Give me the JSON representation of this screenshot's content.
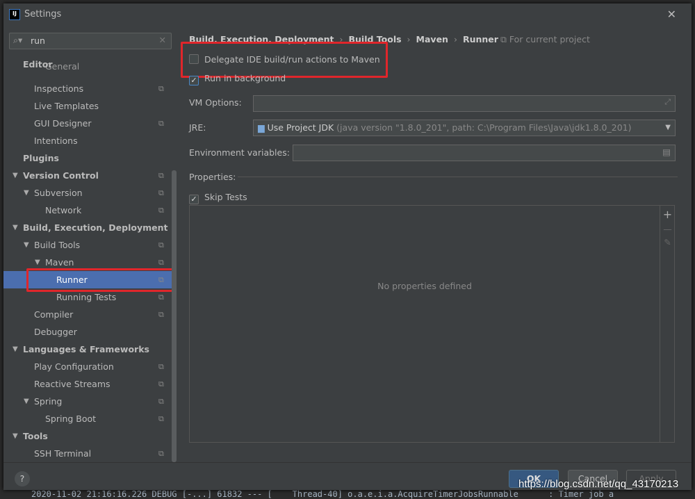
{
  "window": {
    "title": "Settings",
    "logo": "IJ"
  },
  "search": {
    "value": "run"
  },
  "tree": [
    {
      "label": "Editor",
      "level": 0,
      "bold": true,
      "arrow": false,
      "copy": false
    },
    {
      "label": "General",
      "level": 2,
      "bold": false,
      "arrow": false,
      "copy": false
    },
    {
      "label": "Inspections",
      "level": 1,
      "bold": false,
      "arrow": false,
      "copy": true
    },
    {
      "label": "Live Templates",
      "level": 1,
      "bold": false,
      "arrow": false,
      "copy": false
    },
    {
      "label": "GUI Designer",
      "level": 1,
      "bold": false,
      "arrow": false,
      "copy": true
    },
    {
      "label": "Intentions",
      "level": 1,
      "bold": false,
      "arrow": false,
      "copy": false
    },
    {
      "label": "Plugins",
      "level": 0,
      "bold": true,
      "arrow": false,
      "copy": false
    },
    {
      "label": "Version Control",
      "level": 0,
      "bold": true,
      "arrow": true,
      "copy": true
    },
    {
      "label": "Subversion",
      "level": 1,
      "bold": false,
      "arrow": true,
      "copy": true
    },
    {
      "label": "Network",
      "level": 2,
      "bold": false,
      "arrow": false,
      "copy": true
    },
    {
      "label": "Build, Execution, Deployment",
      "level": 0,
      "bold": true,
      "arrow": true,
      "copy": false
    },
    {
      "label": "Build Tools",
      "level": 1,
      "bold": false,
      "arrow": true,
      "copy": true
    },
    {
      "label": "Maven",
      "level": 2,
      "bold": false,
      "arrow": true,
      "copy": true
    },
    {
      "label": "Runner",
      "level": 3,
      "bold": false,
      "arrow": false,
      "copy": true,
      "selected": true
    },
    {
      "label": "Running Tests",
      "level": 3,
      "bold": false,
      "arrow": false,
      "copy": true
    },
    {
      "label": "Compiler",
      "level": 1,
      "bold": false,
      "arrow": false,
      "copy": true
    },
    {
      "label": "Debugger",
      "level": 1,
      "bold": false,
      "arrow": false,
      "copy": false
    },
    {
      "label": "Languages & Frameworks",
      "level": 0,
      "bold": true,
      "arrow": true,
      "copy": false
    },
    {
      "label": "Play Configuration",
      "level": 1,
      "bold": false,
      "arrow": false,
      "copy": true
    },
    {
      "label": "Reactive Streams",
      "level": 1,
      "bold": false,
      "arrow": false,
      "copy": true
    },
    {
      "label": "Spring",
      "level": 1,
      "bold": false,
      "arrow": true,
      "copy": true
    },
    {
      "label": "Spring Boot",
      "level": 2,
      "bold": false,
      "arrow": false,
      "copy": true
    },
    {
      "label": "Tools",
      "level": 0,
      "bold": true,
      "arrow": true,
      "copy": false
    },
    {
      "label": "SSH Terminal",
      "level": 1,
      "bold": false,
      "arrow": false,
      "copy": true
    }
  ],
  "breadcrumb": [
    "Build, Execution, Deployment",
    "Build Tools",
    "Maven",
    "Runner"
  ],
  "scope": "For current project",
  "options": {
    "delegate": {
      "label": "Delegate IDE build/run actions to Maven",
      "checked": false
    },
    "background": {
      "label": "Run in background",
      "checked": true
    },
    "vm_label": "VM Options:",
    "vm_value": "",
    "jre_label": "JRE:",
    "jre_value": "Use Project JDK",
    "jre_detail": "(java version \"1.8.0_201\", path: C:\\Program Files\\Java\\jdk1.8.0_201)",
    "env_label": "Environment variables:",
    "env_value": "",
    "properties_label": "Properties:",
    "skip_tests": {
      "label": "Skip Tests",
      "checked": true
    },
    "empty_text": "No properties defined"
  },
  "footer": {
    "help": "?",
    "ok": "OK",
    "cancel": "Cancel",
    "apply": "Apply"
  },
  "watermark": "https://blog.csdn.net/qq_43170213",
  "background_log": "2020-11-02 21:16:16.226 DEBUG [-...] 61832 --- [    Thread-40] o.a.e.i.a.AcquireTimerJobsRunnable      : Timer job a",
  "colors": {
    "selection": "#4b6eaf",
    "highlight": "#e0262b",
    "ok_button": "#365880"
  }
}
